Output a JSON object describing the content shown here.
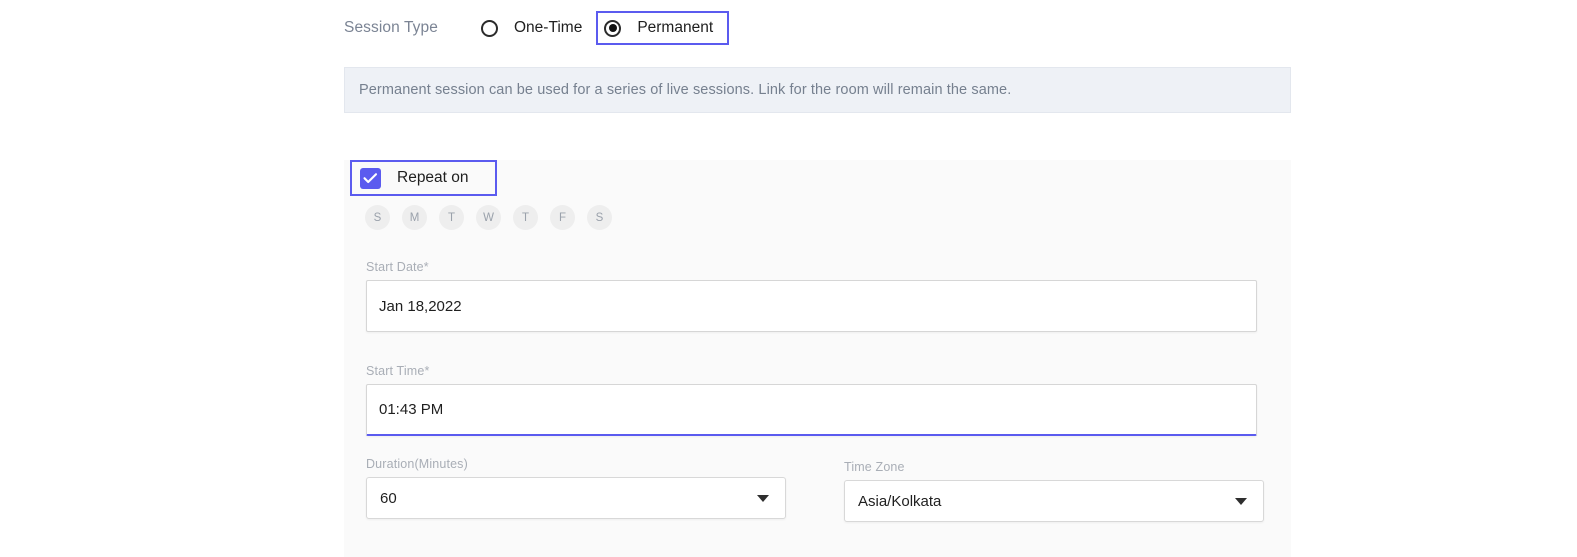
{
  "session_type": {
    "label": "Session Type",
    "options": [
      {
        "label": "One-Time",
        "selected": false,
        "focused": false
      },
      {
        "label": "Permanent",
        "selected": true,
        "focused": true
      }
    ]
  },
  "info_banner": {
    "text": "Permanent session can be used for a series of live sessions. Link for the room will remain the same."
  },
  "repeat": {
    "label": "Repeat on",
    "checked": true,
    "days": [
      {
        "label": "S",
        "selected": false
      },
      {
        "label": "M",
        "selected": false
      },
      {
        "label": "T",
        "selected": false
      },
      {
        "label": "W",
        "selected": false
      },
      {
        "label": "T",
        "selected": false
      },
      {
        "label": "F",
        "selected": false
      },
      {
        "label": "S",
        "selected": false
      }
    ]
  },
  "start_date": {
    "label": "Start Date*",
    "value": "Jan 18,2022"
  },
  "start_time": {
    "label": "Start Time*",
    "value": "01:43 PM"
  },
  "duration": {
    "label": "Duration(Minutes)",
    "value": "60"
  },
  "time_zone": {
    "label": "Time Zone",
    "value": "Asia/Kolkata"
  },
  "colors": {
    "accent": "#5b5bef",
    "banner_bg": "#eef1f6",
    "panel_bg": "#fafafa",
    "muted_text": "#a9aeb6"
  }
}
